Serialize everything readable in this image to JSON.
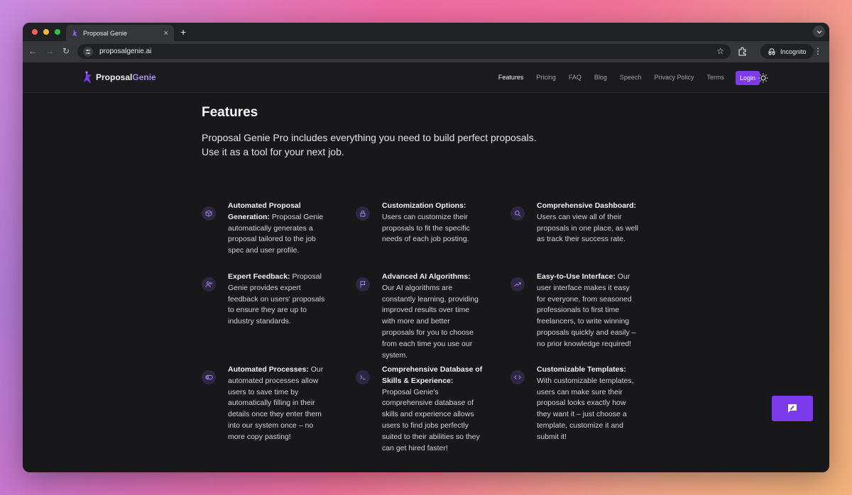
{
  "browser": {
    "tab_title": "Proposal Genie",
    "tab_close": "×",
    "new_tab": "+",
    "url": "proposalgenie.ai",
    "incognito_label": "Incognito"
  },
  "site": {
    "logo_part1": "Proposal",
    "logo_part2": "Genie",
    "nav": [
      "Features",
      "Pricing",
      "FAQ",
      "Blog",
      "Speech",
      "Privacy Policy",
      "Terms"
    ],
    "login_label": "Login"
  },
  "main": {
    "title": "Features",
    "lead": "Proposal Genie Pro includes everything you need to build perfect proposals. Use it as a tool for your next job."
  },
  "features": [
    {
      "icon": "cube-icon",
      "title": "Automated Proposal Generation:",
      "text": "Proposal Genie automatically generates a proposal tailored to the job spec and user profile."
    },
    {
      "icon": "lock-icon",
      "title": "Customization Options:",
      "text": "Users can customize their proposals to fit the specific needs of each job posting."
    },
    {
      "icon": "search-icon",
      "title": "Comprehensive Dashboard:",
      "text": "Users can view all of their proposals in one place, as well as track their success rate."
    },
    {
      "icon": "user-plus-icon",
      "title": "Expert Feedback:",
      "text": "Proposal Genie provides expert feedback on users' proposals to ensure they are up to industry standards."
    },
    {
      "icon": "flag-icon",
      "title": "Advanced AI Algorithms:",
      "text": "Our AI algorithms are constantly learning, providing improved results over time with more and better proposals for you to choose from each time you use our system."
    },
    {
      "icon": "trending-up-icon",
      "title": "Easy-to-Use Interface:",
      "text": "Our user interface makes it easy for everyone, from seasoned professionals to first time freelancers, to write winning proposals quickly and easily – no prior knowledge required!"
    },
    {
      "icon": "toggle-icon",
      "title": "Automated Processes:",
      "text": "Our automated processes allow users to save time by automatically filling in their details once they enter them into our system once – no more copy pasting!"
    },
    {
      "icon": "terminal-icon",
      "title": "Comprehensive Database of Skills & Experience:",
      "text": "Proposal Genie's comprehensive database of skills and experience allows users to find jobs perfectly suited to their abilities so they can get hired faster!"
    },
    {
      "icon": "code-icon",
      "title": "Customizable Templates:",
      "text": "With customizable templates, users can make sure their proposal looks exactly how they want it – just choose a template, customize it and submit it!"
    }
  ],
  "colors": {
    "accent": "#7c3aed",
    "logo_accent": "#a98bf5",
    "background": "#18181b"
  }
}
